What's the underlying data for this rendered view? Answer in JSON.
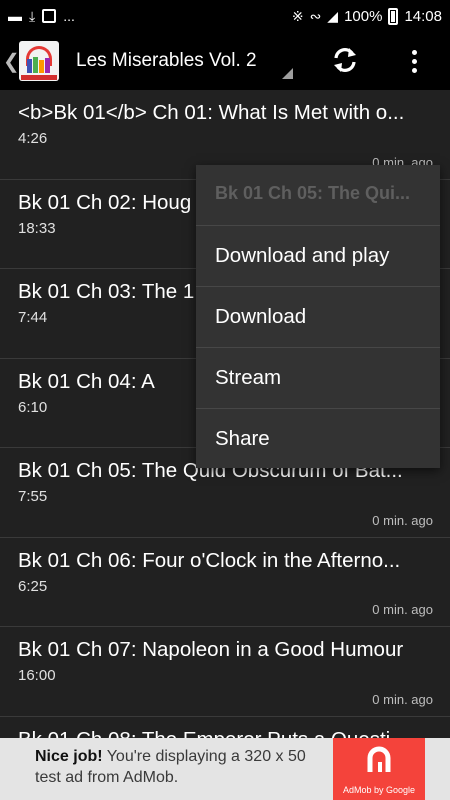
{
  "status_bar": {
    "signal": "100%",
    "time": "14:08",
    "overflow": "..."
  },
  "toolbar": {
    "title": "Les Miserables Vol. 2"
  },
  "list": [
    {
      "title": "<b>Bk 01</b> Ch 01: What Is Met with o...",
      "duration": "4:26",
      "time": "0 min. ago"
    },
    {
      "title": "Bk 01 Ch 02: Houg",
      "duration": "18:33",
      "time": ""
    },
    {
      "title": "Bk 01 Ch 03: The 1",
      "duration": "7:44",
      "time": ""
    },
    {
      "title": "Bk 01 Ch 04: A",
      "duration": "6:10",
      "time": ""
    },
    {
      "title": "Bk 01 Ch 05: The Quid Obscurum of Bat...",
      "duration": "7:55",
      "time": "0 min. ago"
    },
    {
      "title": "Bk 01 Ch 06: Four o'Clock in the Afterno...",
      "duration": "6:25",
      "time": "0 min. ago"
    },
    {
      "title": "Bk 01 Ch 07: Napoleon in a Good Humour",
      "duration": "16:00",
      "time": "0 min. ago"
    },
    {
      "title": "Bk 01 Ch 08: The Emperor Puts a Questi...",
      "duration": "",
      "time": ""
    }
  ],
  "popup": {
    "header": "Bk 01 Ch 05: The Qui...",
    "items": [
      "Download and play",
      "Download",
      "Stream",
      "Share"
    ]
  },
  "ad": {
    "headline": "Nice job!",
    "body": " You're displaying a 320 x 50 test ad from AdMob.",
    "brand": "AdMob by Google"
  },
  "colors": {
    "background": "#212121",
    "toolbar": "#000000",
    "popup": "#333333",
    "ad_background": "#e4e4e4",
    "admob_red": "#f4433b"
  }
}
